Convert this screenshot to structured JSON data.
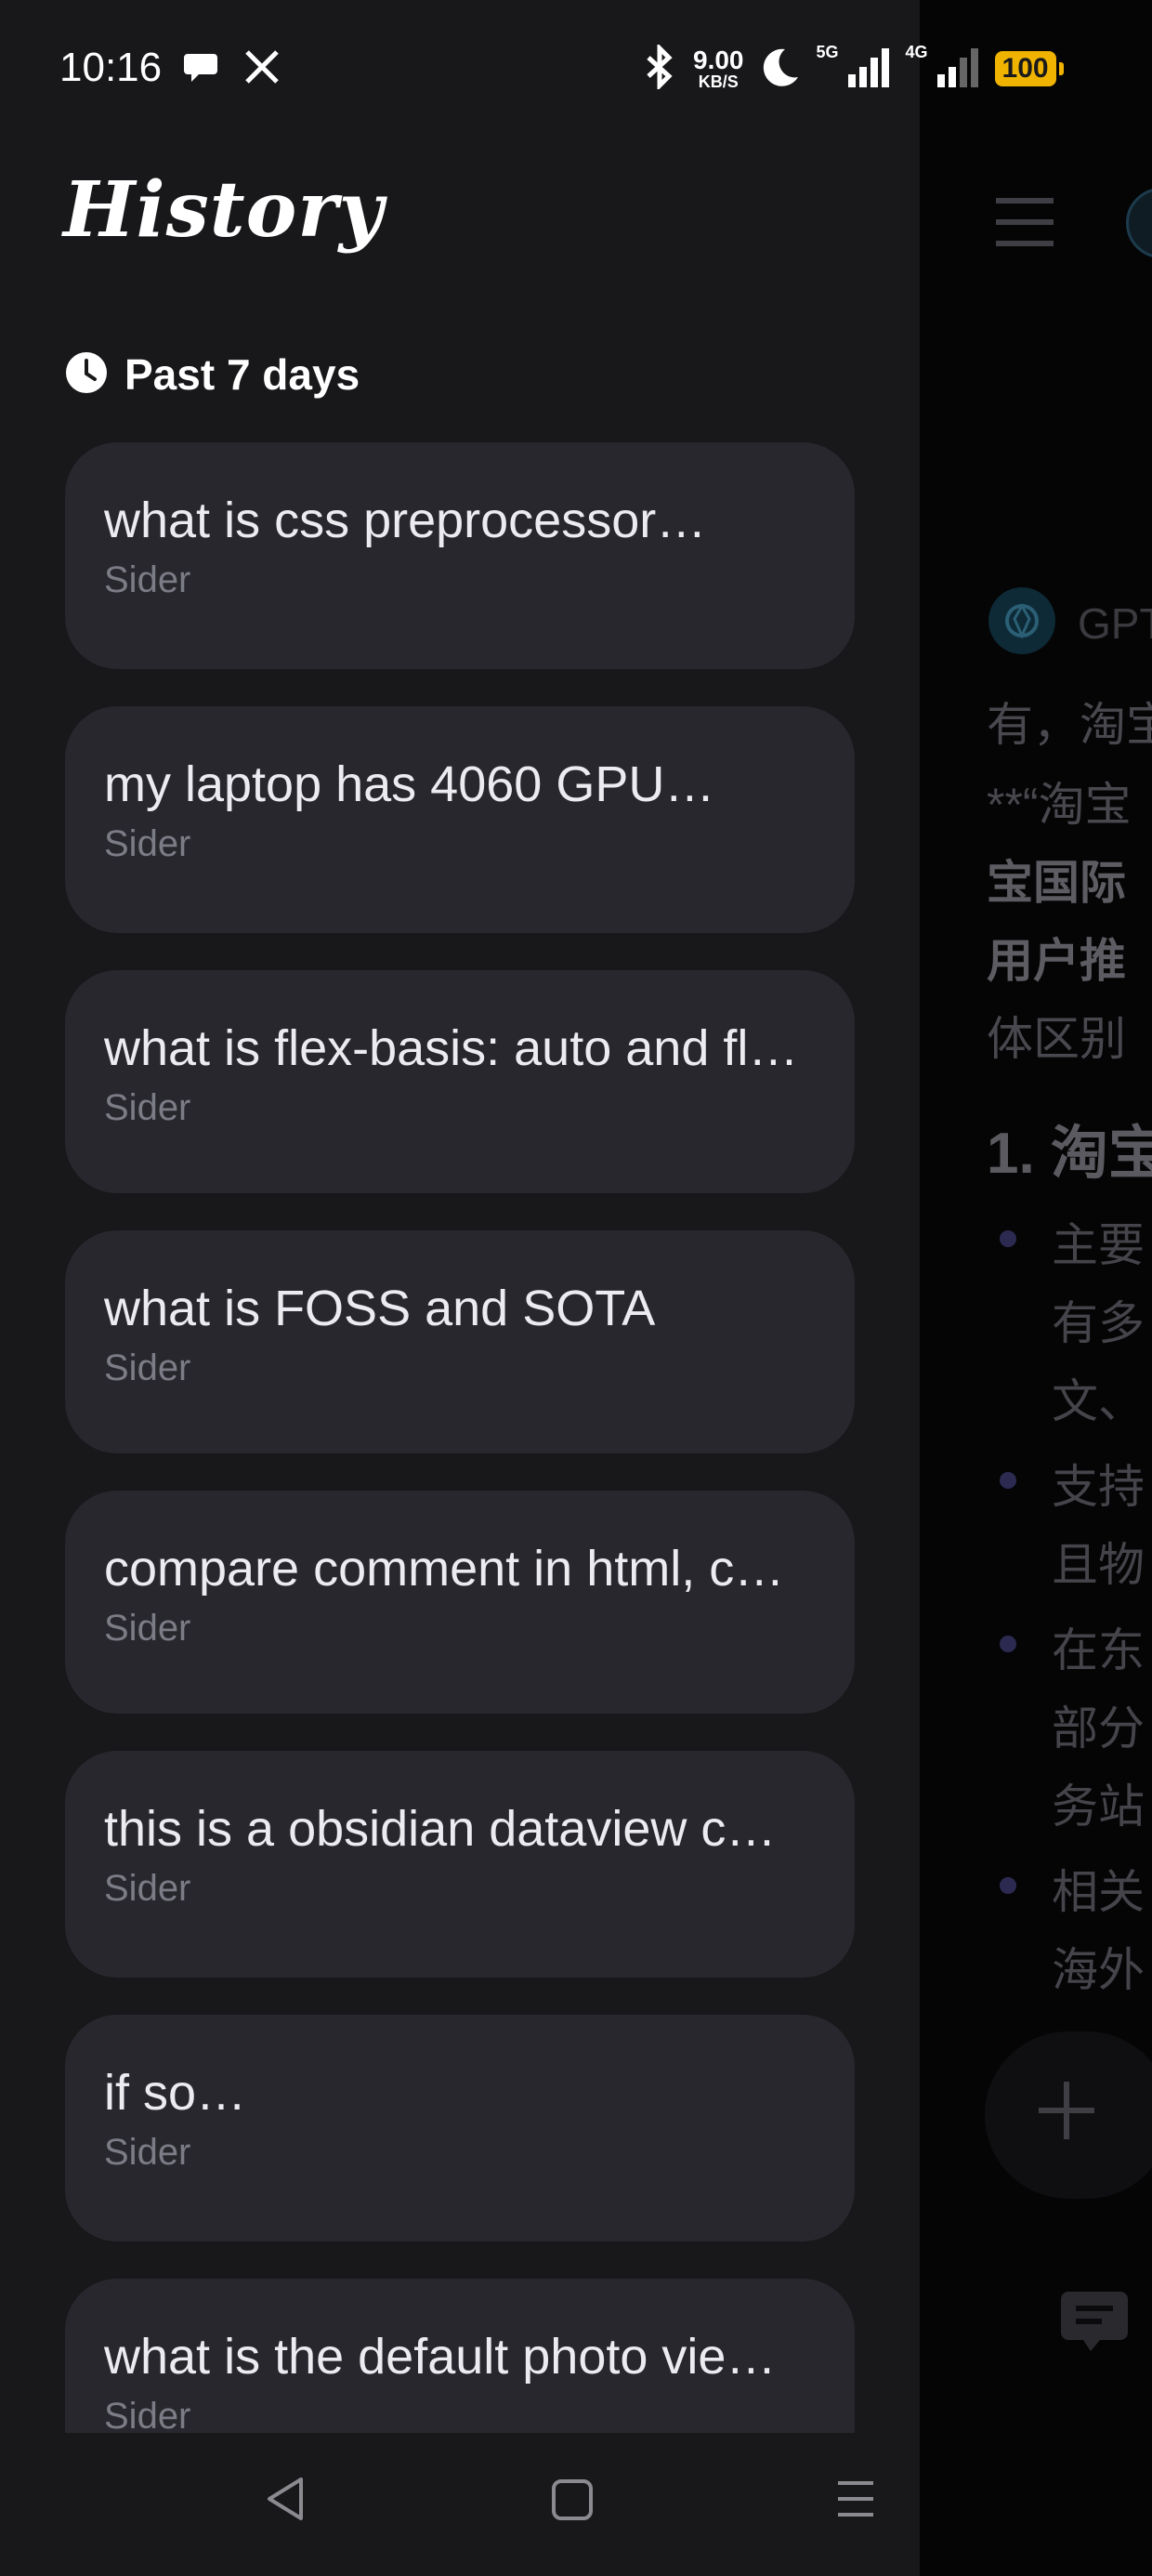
{
  "status_bar": {
    "time": "10:16",
    "left_icons": [
      "chat-bubble-icon",
      "x-logo-icon"
    ],
    "network_speed": "9.00",
    "network_speed_unit": "KB/S",
    "sim1_label": "5G",
    "sim2_label": "4G",
    "battery": "100",
    "right_icons": [
      "bluetooth-icon",
      "moon-icon",
      "signal-5g-icon",
      "signal-4g-icon"
    ]
  },
  "drawer": {
    "title": "History",
    "section_label": "Past 7 days",
    "items": [
      {
        "title": "what is css preprocessor…",
        "source": "Sider"
      },
      {
        "title": "my laptop has 4060 GPU…",
        "source": "Sider"
      },
      {
        "title": "what is flex-basis: auto and fl…",
        "source": "Sider"
      },
      {
        "title": "what is FOSS and SOTA",
        "source": "Sider"
      },
      {
        "title": "compare comment in html, c…",
        "source": "Sider"
      },
      {
        "title": "this is a obsidian dataview c…",
        "source": "Sider"
      },
      {
        "title": "if so…",
        "source": "Sider"
      },
      {
        "title": "what is the default photo vie…",
        "source": "Sider"
      }
    ]
  },
  "chat_behind": {
    "model_name": "GPT",
    "lines": [
      "有，淘宝",
      "**“淘宝",
      "宝国际",
      "用户推",
      "体区别"
    ],
    "heading": "1. 淘宝",
    "bullets": [
      [
        "主要",
        "有多",
        "文、"
      ],
      [
        "支持",
        "且物"
      ],
      [
        "在东",
        "部分",
        "务站"
      ],
      [
        "相关",
        "海外"
      ]
    ]
  },
  "nav": {
    "icons": [
      "back-icon",
      "home-icon",
      "recents-icon"
    ]
  },
  "colors": {
    "drawer_bg": "#18181b",
    "card_bg": "#27272d",
    "secondary_text": "#7c7c86",
    "battery": "#f0b400"
  }
}
